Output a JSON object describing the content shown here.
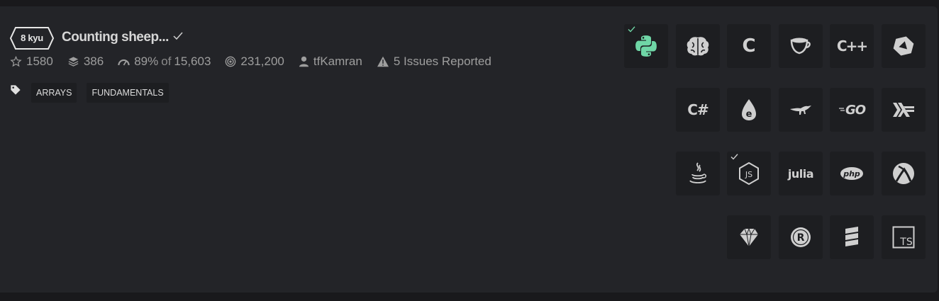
{
  "kata": {
    "rank": "8 kyu",
    "title": "Counting sheep...",
    "stats": {
      "stars": "1580",
      "collections": "386",
      "satisfaction": "89%",
      "of_label": "of",
      "votes": "15,603",
      "completed": "231,200",
      "author": "tfKamran",
      "issues": "5 Issues Reported"
    },
    "tags": [
      "ARRAYS",
      "FUNDAMENTALS"
    ]
  },
  "languages": [
    {
      "name": "python",
      "icon": "python-icon",
      "completed": true,
      "active": true
    },
    {
      "name": "brainfuck",
      "icon": "brain-icon"
    },
    {
      "name": "c",
      "icon": "c-icon",
      "label": "C"
    },
    {
      "name": "coffeescript",
      "icon": "coffee-cup-icon"
    },
    {
      "name": "cpp",
      "icon": "cpp-icon",
      "label": "C++"
    },
    {
      "name": "crystal",
      "icon": "crystal-icon"
    },
    {
      "name": "csharp",
      "icon": "csharp-icon",
      "label": "C#"
    },
    {
      "name": "elixir",
      "icon": "elixir-drop-icon",
      "label": "e"
    },
    {
      "name": "elm",
      "icon": "raptor-icon"
    },
    {
      "name": "go",
      "icon": "go-icon",
      "label": "GO"
    },
    {
      "name": "haskell",
      "icon": "haskell-icon"
    },
    {
      "name": "java",
      "icon": "java-cup-icon"
    },
    {
      "name": "javascript",
      "icon": "nodejs-hexagon-icon",
      "label": "JS",
      "completed": true
    },
    {
      "name": "julia",
      "icon": "julia-icon",
      "label": "julia"
    },
    {
      "name": "php",
      "icon": "php-icon",
      "label": "php"
    },
    {
      "name": "racket",
      "icon": "racket-icon"
    },
    {
      "name": "ruby",
      "icon": "ruby-gem-icon"
    },
    {
      "name": "rust",
      "icon": "rust-gear-icon",
      "label": "R"
    },
    {
      "name": "scala",
      "icon": "scala-icon"
    },
    {
      "name": "typescript",
      "icon": "typescript-icon",
      "label": "TS"
    }
  ],
  "colors": {
    "page_bg": "#19191c",
    "card_bg": "#232428",
    "tile_bg": "#1d1e21",
    "accent_green": "#6fd6a6",
    "icon_grey": "#cfcfcf"
  }
}
